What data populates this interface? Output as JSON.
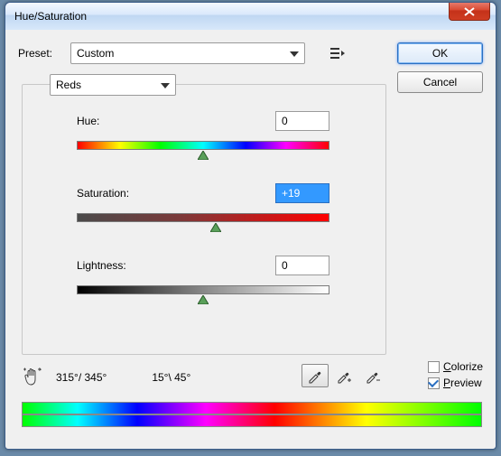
{
  "window": {
    "title": "Hue/Saturation"
  },
  "buttons": {
    "ok": "OK",
    "cancel": "Cancel"
  },
  "preset": {
    "label": "Preset:",
    "value": "Custom"
  },
  "channel": {
    "value": "Reds"
  },
  "sliders": {
    "hue": {
      "label": "Hue:",
      "value": "0",
      "selected": false,
      "thumb_pct": 50
    },
    "saturation": {
      "label": "Saturation:",
      "value": "+19",
      "selected": true,
      "thumb_pct": 55
    },
    "lightness": {
      "label": "Lightness:",
      "value": "0",
      "selected": false,
      "thumb_pct": 50
    }
  },
  "angles": {
    "left": "315°/ 345°",
    "right": "15°\\ 45°"
  },
  "checkboxes": {
    "colorize": {
      "label": "Colorize",
      "ul": "C",
      "checked": false
    },
    "preview": {
      "label": "Preview",
      "ul": "P",
      "checked": true
    }
  },
  "range": {
    "outer_left_pct": 40,
    "inner_left_pct": 47,
    "inner_right_pct": 56,
    "outer_right_pct": 63
  }
}
